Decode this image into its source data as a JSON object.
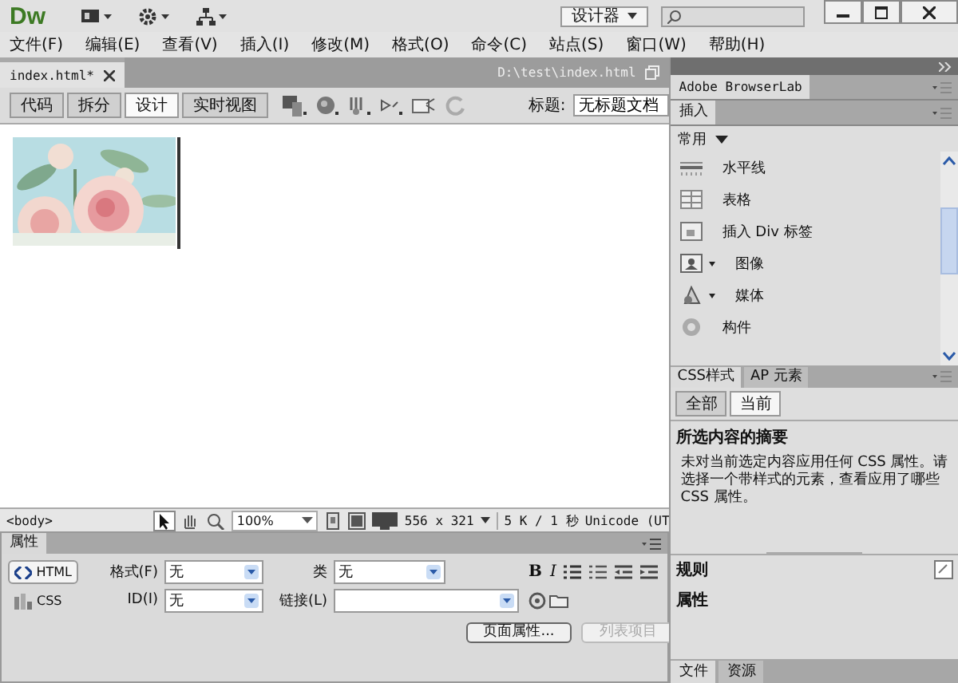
{
  "app": {
    "logo": "Dw",
    "workspace": "设计器"
  },
  "menu": [
    "文件(F)",
    "编辑(E)",
    "查看(V)",
    "插入(I)",
    "修改(M)",
    "格式(O)",
    "命令(C)",
    "站点(S)",
    "窗口(W)",
    "帮助(H)"
  ],
  "document_tab": {
    "label": "index.html*",
    "path": "D:\\test\\index.html"
  },
  "view_buttons": [
    {
      "label": "代码",
      "selected": false
    },
    {
      "label": "拆分",
      "selected": false
    },
    {
      "label": "设计",
      "selected": true
    },
    {
      "label": "实时视图",
      "selected": false
    }
  ],
  "title_field": {
    "label": "标题:",
    "value": "无标题文档"
  },
  "status_bar": {
    "tag": "<body>",
    "zoom": "100%",
    "size": "556 x 321",
    "download": "5 K / 1 秒",
    "encoding": "Unicode (UT"
  },
  "properties": {
    "title": "属性",
    "modes": [
      {
        "label": "HTML",
        "selected": true
      },
      {
        "label": "CSS",
        "selected": false
      }
    ],
    "format": {
      "label": "格式(F)",
      "value": "无"
    },
    "id": {
      "label": "ID(I)",
      "value": "无"
    },
    "class": {
      "label": "类",
      "value": "无"
    },
    "link": {
      "label": "链接(L)"
    },
    "bold": "B",
    "italic": "I",
    "page_properties": "页面属性...",
    "list_item": {
      "label": "列表项目",
      "disabled": true
    }
  },
  "panels": {
    "browserlab": "Adobe BrowserLab",
    "insert": {
      "title": "插入",
      "category": "常用",
      "items": [
        {
          "label": "水平线",
          "has_menu": false
        },
        {
          "label": "表格",
          "has_menu": false
        },
        {
          "label": "插入 Div 标签",
          "has_menu": false
        },
        {
          "label": "图像",
          "has_menu": true
        },
        {
          "label": "媒体",
          "has_menu": true
        },
        {
          "label": "构件",
          "has_menu": false
        }
      ]
    },
    "css": {
      "tabs": [
        {
          "label": "CSS样式",
          "selected": true
        },
        {
          "label": "AP 元素",
          "selected": false
        }
      ],
      "modes": [
        {
          "label": "全部",
          "selected": false
        },
        {
          "label": "当前",
          "selected": true
        }
      ],
      "summary_title": "所选内容的摘要",
      "message": "未对当前选定内容应用任何 CSS 属性。请选择一个带样式的元素，查看应用了哪些 CSS 属性。",
      "rules": "规则",
      "properties": "属性"
    },
    "bottom_tabs": [
      {
        "label": "文件",
        "selected": true
      },
      {
        "label": "资源",
        "selected": false
      }
    ]
  }
}
